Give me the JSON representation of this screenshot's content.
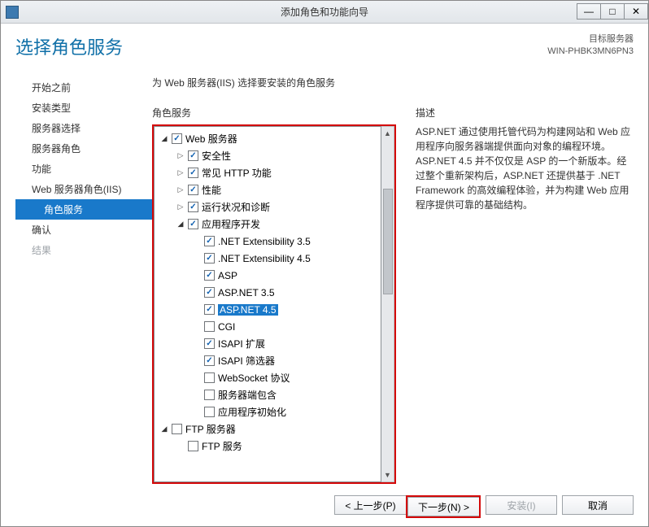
{
  "window": {
    "title": "添加角色和功能向导"
  },
  "header": {
    "page_title": "选择角色服务",
    "target_label": "目标服务器",
    "target_value": "WIN-PHBK3MN6PN3"
  },
  "sidebar": {
    "items": [
      {
        "label": "开始之前",
        "state": "normal"
      },
      {
        "label": "安装类型",
        "state": "normal"
      },
      {
        "label": "服务器选择",
        "state": "normal"
      },
      {
        "label": "服务器角色",
        "state": "normal"
      },
      {
        "label": "功能",
        "state": "normal"
      },
      {
        "label": "Web 服务器角色(IIS)",
        "state": "normal"
      },
      {
        "label": "角色服务",
        "state": "selected",
        "indent": true
      },
      {
        "label": "确认",
        "state": "normal"
      },
      {
        "label": "结果",
        "state": "disabled"
      }
    ]
  },
  "main": {
    "instruction": "为 Web 服务器(IIS) 选择要安装的角色服务",
    "roles_header": "角色服务",
    "desc_header": "描述",
    "description": "ASP.NET 通过使用托管代码为构建网站和 Web 应用程序向服务器端提供面向对象的编程环境。ASP.NET 4.5 并不仅仅是 ASP 的一个新版本。经过整个重新架构后，ASP.NET 还提供基于 .NET Framework 的高效编程体验，并为构建 Web 应用程序提供可靠的基础结构。"
  },
  "tree": [
    {
      "level": 0,
      "exp": "open",
      "chk": "checked",
      "label": "Web 服务器"
    },
    {
      "level": 1,
      "exp": "closed",
      "chk": "checked",
      "label": "安全性"
    },
    {
      "level": 1,
      "exp": "closed",
      "chk": "checked",
      "label": "常见 HTTP 功能"
    },
    {
      "level": 1,
      "exp": "closed",
      "chk": "checked",
      "label": "性能"
    },
    {
      "level": 1,
      "exp": "closed",
      "chk": "checked",
      "label": "运行状况和诊断"
    },
    {
      "level": 1,
      "exp": "open",
      "chk": "checked",
      "label": "应用程序开发"
    },
    {
      "level": 2,
      "exp": "",
      "chk": "checked",
      "label": ".NET Extensibility 3.5"
    },
    {
      "level": 2,
      "exp": "",
      "chk": "checked",
      "label": ".NET Extensibility 4.5"
    },
    {
      "level": 2,
      "exp": "",
      "chk": "checked",
      "label": "ASP"
    },
    {
      "level": 2,
      "exp": "",
      "chk": "checked",
      "label": "ASP.NET 3.5"
    },
    {
      "level": 2,
      "exp": "",
      "chk": "checked",
      "label": "ASP.NET 4.5",
      "selected": true
    },
    {
      "level": 2,
      "exp": "",
      "chk": "",
      "label": "CGI"
    },
    {
      "level": 2,
      "exp": "",
      "chk": "checked",
      "label": "ISAPI 扩展"
    },
    {
      "level": 2,
      "exp": "",
      "chk": "checked",
      "label": "ISAPI 筛选器"
    },
    {
      "level": 2,
      "exp": "",
      "chk": "",
      "label": "WebSocket 协议"
    },
    {
      "level": 2,
      "exp": "",
      "chk": "",
      "label": "服务器端包含"
    },
    {
      "level": 2,
      "exp": "",
      "chk": "",
      "label": "应用程序初始化"
    },
    {
      "level": 0,
      "exp": "open",
      "chk": "",
      "label": "FTP 服务器"
    },
    {
      "level": 1,
      "exp": "",
      "chk": "",
      "label": "FTP 服务"
    }
  ],
  "footer": {
    "prev": "< 上一步(P)",
    "next": "下一步(N) >",
    "install": "安装(I)",
    "cancel": "取消"
  }
}
